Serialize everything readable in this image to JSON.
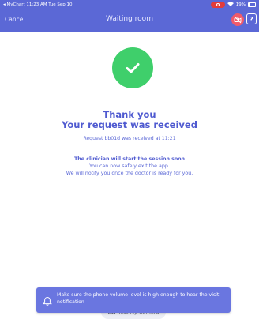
{
  "status_bar": {
    "carrier": "◂ MyChart",
    "time_date": "11:23 AM  Tue Sep 10",
    "battery": "19%",
    "colors": {
      "bg": "#5b68d6",
      "record": "#e23b3b"
    }
  },
  "nav": {
    "cancel_label": "Cancel",
    "title": "Waiting room",
    "camera_icon": "camera-off-icon",
    "help_icon": "help-icon",
    "help_glyph": "?"
  },
  "main": {
    "success_icon": "check-icon",
    "thank_you": "Thank you",
    "request_received": "Your request was received",
    "request_line": "Request bb01d was received at 11:21",
    "clinician_line": "The clinician will start the session soon",
    "exit_line": "You can now safely exit the app.",
    "notify_line": "We will notify you once the doctor is ready for you.",
    "test_camera_label": "Test My Camera"
  },
  "toast": {
    "icon": "bell-icon",
    "message": "Make sure the phone volume level is high enough to hear the visit notification"
  },
  "colors": {
    "accent": "#5b68d6",
    "success": "#3fcf6b",
    "toast": "#6a76e0",
    "camera_off": "#f15a6a"
  }
}
